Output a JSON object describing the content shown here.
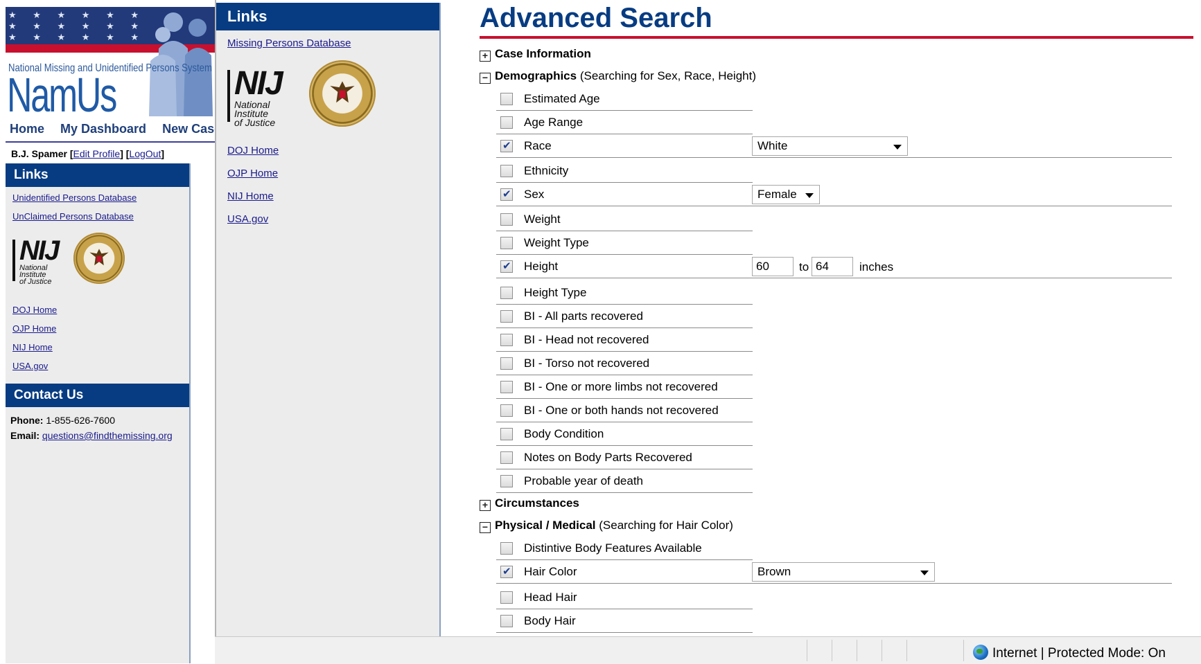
{
  "back_window": {
    "tagline": "National Missing and Unidentified Persons System",
    "logo": "NamUs",
    "nav": [
      "Home",
      "My Dashboard",
      "New Case"
    ],
    "user": {
      "name": "B.J. Spamer",
      "edit_profile": "Edit Profile",
      "logout": "LogOut"
    },
    "links_title": "Links",
    "links": [
      "Unidentified Persons Database",
      "UnClaimed Persons Database"
    ],
    "nij": {
      "big": "NIJ",
      "line1": "National",
      "line2": "Institute",
      "line3": "of Justice"
    },
    "gov_links": [
      "DOJ Home",
      "OJP Home",
      "NIJ Home",
      "USA.gov"
    ],
    "contact_title": "Contact Us",
    "phone_label": "Phone:",
    "phone": "1-855-626-7600",
    "email_label": "Email:",
    "email": "questions@findthemissing.org"
  },
  "front_window": {
    "links_title": "Links",
    "database_link": "Missing Persons Database",
    "nij": {
      "big": "NIJ",
      "line1": "National",
      "line2": "Institute",
      "line3": "of Justice"
    },
    "gov_links": [
      "DOJ Home",
      "OJP Home",
      "NIJ Home",
      "USA.gov"
    ],
    "page_title": "Advanced Search",
    "sections": {
      "case_info": {
        "toggle": "+",
        "title": "Case Information",
        "note": ""
      },
      "demographics": {
        "toggle": "−",
        "title": "Demographics",
        "note": "(Searching for Sex, Race, Height)"
      },
      "circumstances": {
        "toggle": "+",
        "title": "Circumstances",
        "note": ""
      },
      "physical": {
        "toggle": "−",
        "title": "Physical / Medical",
        "note": "(Searching for Hair Color)"
      }
    },
    "demographic_fields": [
      {
        "label": "Estimated Age",
        "checked": false
      },
      {
        "label": "Age Range",
        "checked": false
      },
      {
        "label": "Race",
        "checked": true,
        "value": "White"
      },
      {
        "label": "Ethnicity",
        "checked": false
      },
      {
        "label": "Sex",
        "checked": true,
        "value": "Female"
      },
      {
        "label": "Weight",
        "checked": false
      },
      {
        "label": "Weight Type",
        "checked": false
      },
      {
        "label": "Height",
        "checked": true,
        "from": "60",
        "to_label": "to",
        "to": "64",
        "unit": "inches"
      },
      {
        "label": "Height Type",
        "checked": false
      },
      {
        "label": "BI - All parts recovered",
        "checked": false
      },
      {
        "label": "BI - Head not recovered",
        "checked": false
      },
      {
        "label": "BI - Torso not recovered",
        "checked": false
      },
      {
        "label": "BI - One or more limbs not recovered",
        "checked": false
      },
      {
        "label": "BI - One or both hands not recovered",
        "checked": false
      },
      {
        "label": "Body Condition",
        "checked": false
      },
      {
        "label": "Notes on Body Parts Recovered",
        "checked": false
      },
      {
        "label": "Probable year of death",
        "checked": false
      }
    ],
    "physical_fields": [
      {
        "label": "Distintive Body Features Available",
        "checked": false
      },
      {
        "label": "Hair Color",
        "checked": true,
        "value": "Brown"
      },
      {
        "label": "Head Hair",
        "checked": false
      },
      {
        "label": "Body Hair",
        "checked": false
      }
    ]
  },
  "status_bar": {
    "zone": "Internet | Protected Mode: On"
  },
  "colors": {
    "header_blue": "#073c82",
    "title_rule_red": "#c8102e",
    "sidebar_gray": "#ececec"
  }
}
